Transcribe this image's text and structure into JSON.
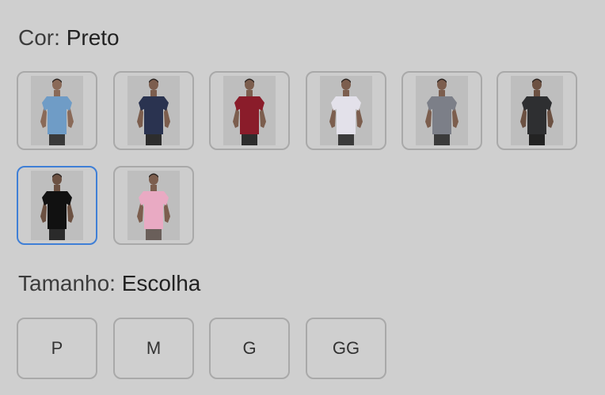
{
  "color": {
    "label": "Cor:",
    "value": "Preto",
    "swatches": [
      {
        "shirt": "#6f9cc6",
        "skin": "#8a6a58",
        "pants": "#3a3a3a"
      },
      {
        "shirt": "#2a3350",
        "skin": "#7c5e4e",
        "pants": "#2d2d2d"
      },
      {
        "shirt": "#8a1c2a",
        "skin": "#7c5e4e",
        "pants": "#2d2d2d"
      },
      {
        "shirt": "#e3e1ea",
        "skin": "#7c5e4e",
        "pants": "#3b3b3b"
      },
      {
        "shirt": "#7c7f88",
        "skin": "#7c5e4e",
        "pants": "#3b3b3b"
      },
      {
        "shirt": "#2e2f31",
        "skin": "#6c5142",
        "pants": "#232323"
      },
      {
        "shirt": "#111111",
        "skin": "#6c5142",
        "pants": "#2a2a2a"
      },
      {
        "shirt": "#e9aac3",
        "skin": "#7c5e4e",
        "pants": "#6a5f5a"
      }
    ],
    "selected_index": 6
  },
  "size": {
    "label": "Tamanho:",
    "value": "Escolha",
    "options": [
      "P",
      "M",
      "G",
      "GG"
    ]
  }
}
